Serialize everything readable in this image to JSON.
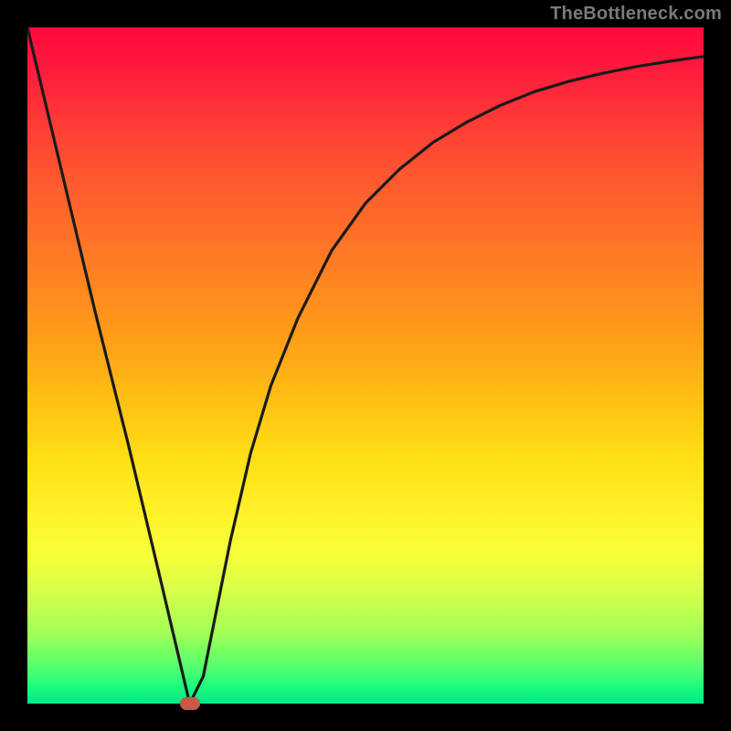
{
  "watermark": "TheBottleneck.com",
  "chart_data": {
    "type": "line",
    "title": "",
    "xlabel": "",
    "ylabel": "",
    "xlim": [
      0,
      100
    ],
    "ylim": [
      0,
      100
    ],
    "grid": false,
    "series": [
      {
        "name": "curve",
        "x": [
          0,
          5,
          10,
          15,
          20,
          24,
          26,
          28,
          30,
          33,
          36,
          40,
          45,
          50,
          55,
          60,
          65,
          70,
          75,
          80,
          85,
          90,
          95,
          100
        ],
        "y": [
          100,
          79,
          58,
          38,
          17,
          0,
          4,
          14,
          24,
          37,
          47,
          57,
          67,
          74,
          79,
          83,
          86,
          88.5,
          90.5,
          92,
          93.2,
          94.2,
          95,
          95.7
        ]
      }
    ],
    "marker": {
      "x": 24,
      "y": 0
    }
  }
}
